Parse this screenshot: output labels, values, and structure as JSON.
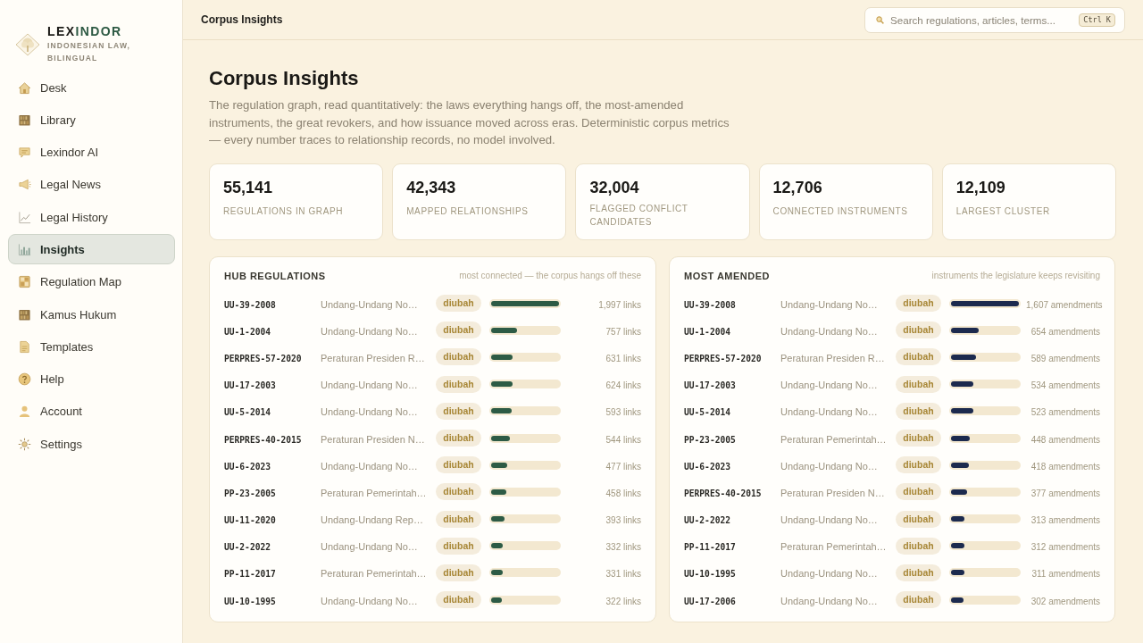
{
  "brand": {
    "name": "**LEX**INDOR",
    "tagline": "INDONESIAN LAW, BILINGUAL"
  },
  "sidebar": {
    "items": [
      {
        "label": "Desk",
        "selected": false
      },
      {
        "label": "Library",
        "selected": false
      },
      {
        "label": "Lexindor AI",
        "selected": false
      },
      {
        "label": "Legal News",
        "selected": false
      },
      {
        "label": "Legal History",
        "selected": false
      },
      {
        "label": "Insights",
        "selected": true
      },
      {
        "label": "Regulation Map",
        "selected": false
      },
      {
        "label": "Kamus Hukum",
        "selected": false
      },
      {
        "label": "Templates",
        "selected": false
      },
      {
        "label": "Help",
        "selected": false
      },
      {
        "label": "Account",
        "selected": false
      },
      {
        "label": "Settings",
        "selected": false
      }
    ]
  },
  "topbar": {
    "title": "Corpus Insights",
    "search": {
      "placeholder": "Search regulations, articles, terms...",
      "shortcut": "Ctrl K"
    }
  },
  "page": {
    "title": "Corpus Insights",
    "description": "The regulation graph, read quantitatively: the laws everything hangs off, the most-amended instruments, the great revokers, and how issuance moved across eras. Deterministic corpus metrics — every number traces to relationship records, no model involved."
  },
  "stats": [
    {
      "value": "55,141",
      "label": "REGULATIONS IN GRAPH"
    },
    {
      "value": "42,343",
      "label": "MAPPED RELATIONSHIPS"
    },
    {
      "value": "32,004",
      "label": "FLAGGED CONFLICT CANDIDATES"
    },
    {
      "value": "12,706",
      "label": "CONNECTED INSTRUMENTS"
    },
    {
      "value": "12,109",
      "label": "LARGEST CLUSTER"
    }
  ],
  "panels": [
    {
      "title": "HUB REGULATIONS",
      "subtitle": "most connected — the corpus hangs off these",
      "color": "#2d5b45",
      "rows": [
        {
          "code": "UU-39-2008",
          "name": "Undang-Undang No…",
          "status": "diubah",
          "level": 1,
          "value": "1,997 links"
        },
        {
          "code": "UU-1-2004",
          "name": "Undang-Undang No…",
          "status": "diubah",
          "level": 0.379,
          "value": "757 links"
        },
        {
          "code": "PERPRES-57-2020",
          "name": "Peraturan Presiden R…",
          "status": "diubah",
          "level": 0.316,
          "value": "631 links"
        },
        {
          "code": "UU-17-2003",
          "name": "Undang-Undang No…",
          "status": "diubah",
          "level": 0.312,
          "value": "624 links"
        },
        {
          "code": "UU-5-2014",
          "name": "Undang-Undang No…",
          "status": "diubah",
          "level": 0.297,
          "value": "593 links"
        },
        {
          "code": "PERPRES-40-2015",
          "name": "Peraturan Presiden N…",
          "status": "diubah",
          "level": 0.272,
          "value": "544 links"
        },
        {
          "code": "UU-6-2023",
          "name": "Undang-Undang No…",
          "status": "diubah",
          "level": 0.239,
          "value": "477 links"
        },
        {
          "code": "PP-23-2005",
          "name": "Peraturan Pemerintah…",
          "status": "diubah",
          "level": 0.229,
          "value": "458 links"
        },
        {
          "code": "UU-11-2020",
          "name": "Undang-Undang Rep…",
          "status": "diubah",
          "level": 0.197,
          "value": "393 links"
        },
        {
          "code": "UU-2-2022",
          "name": "Undang-Undang No…",
          "status": "diubah",
          "level": 0.166,
          "value": "332 links"
        },
        {
          "code": "PP-11-2017",
          "name": "Peraturan Pemerintah…",
          "status": "diubah",
          "level": 0.166,
          "value": "331 links"
        },
        {
          "code": "UU-10-1995",
          "name": "Undang-Undang No…",
          "status": "diubah",
          "level": 0.161,
          "value": "322 links"
        }
      ]
    },
    {
      "title": "MOST AMENDED",
      "subtitle": "instruments the legislature keeps revisiting",
      "color": "#1c2a4e",
      "rows": [
        {
          "code": "UU-39-2008",
          "name": "Undang-Undang No…",
          "status": "diubah",
          "level": 1,
          "value": "1,607 amendments"
        },
        {
          "code": "UU-1-2004",
          "name": "Undang-Undang No…",
          "status": "diubah",
          "level": 0.407,
          "value": "654 amendments"
        },
        {
          "code": "PERPRES-57-2020",
          "name": "Peraturan Presiden R…",
          "status": "diubah",
          "level": 0.367,
          "value": "589 amendments"
        },
        {
          "code": "UU-17-2003",
          "name": "Undang-Undang No…",
          "status": "diubah",
          "level": 0.332,
          "value": "534 amendments"
        },
        {
          "code": "UU-5-2014",
          "name": "Undang-Undang No…",
          "status": "diubah",
          "level": 0.325,
          "value": "523 amendments"
        },
        {
          "code": "PP-23-2005",
          "name": "Peraturan Pemerintah…",
          "status": "diubah",
          "level": 0.279,
          "value": "448 amendments"
        },
        {
          "code": "UU-6-2023",
          "name": "Undang-Undang No…",
          "status": "diubah",
          "level": 0.26,
          "value": "418 amendments"
        },
        {
          "code": "PERPRES-40-2015",
          "name": "Peraturan Presiden N…",
          "status": "diubah",
          "level": 0.235,
          "value": "377 amendments"
        },
        {
          "code": "UU-2-2022",
          "name": "Undang-Undang No…",
          "status": "diubah",
          "level": 0.195,
          "value": "313 amendments"
        },
        {
          "code": "PP-11-2017",
          "name": "Peraturan Pemerintah…",
          "status": "diubah",
          "level": 0.194,
          "value": "312 amendments"
        },
        {
          "code": "UU-10-1995",
          "name": "Undang-Undang No…",
          "status": "diubah",
          "level": 0.194,
          "value": "311 amendments"
        },
        {
          "code": "UU-17-2006",
          "name": "Undang-Undang No…",
          "status": "diubah",
          "level": 0.188,
          "value": "302 amendments"
        }
      ]
    }
  ]
}
